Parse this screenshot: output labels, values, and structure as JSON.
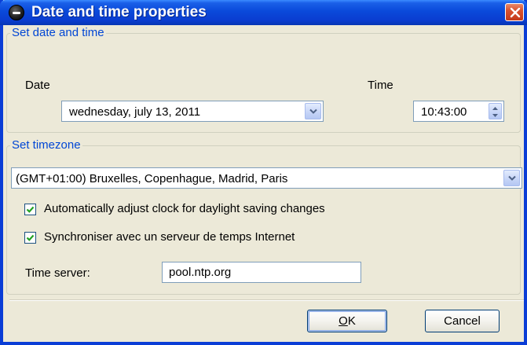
{
  "window": {
    "title": "Date and time properties"
  },
  "date_time_group": {
    "label": "Set date and time",
    "date_label": "Date",
    "date_value": "wednesday, july 13, 2011",
    "time_label": "Time",
    "time_value": "10:43:00"
  },
  "timezone_group": {
    "label": "Set timezone",
    "timezone_value": "(GMT+01:00) Bruxelles, Copenhague, Madrid, Paris",
    "dst_checkbox_label": "Automatically adjust clock for daylight saving changes",
    "dst_checked": true,
    "sync_checkbox_label": "Synchroniser avec un serveur de temps Internet",
    "sync_checked": true,
    "time_server_label": "Time server:",
    "time_server_value": "pool.ntp.org"
  },
  "buttons": {
    "ok_label": "OK",
    "cancel_label": "Cancel"
  },
  "colors": {
    "accent": "#0046d5",
    "titlebar": "#0a49da",
    "close": "#d8512f",
    "window_bg": "#ece9d8"
  }
}
